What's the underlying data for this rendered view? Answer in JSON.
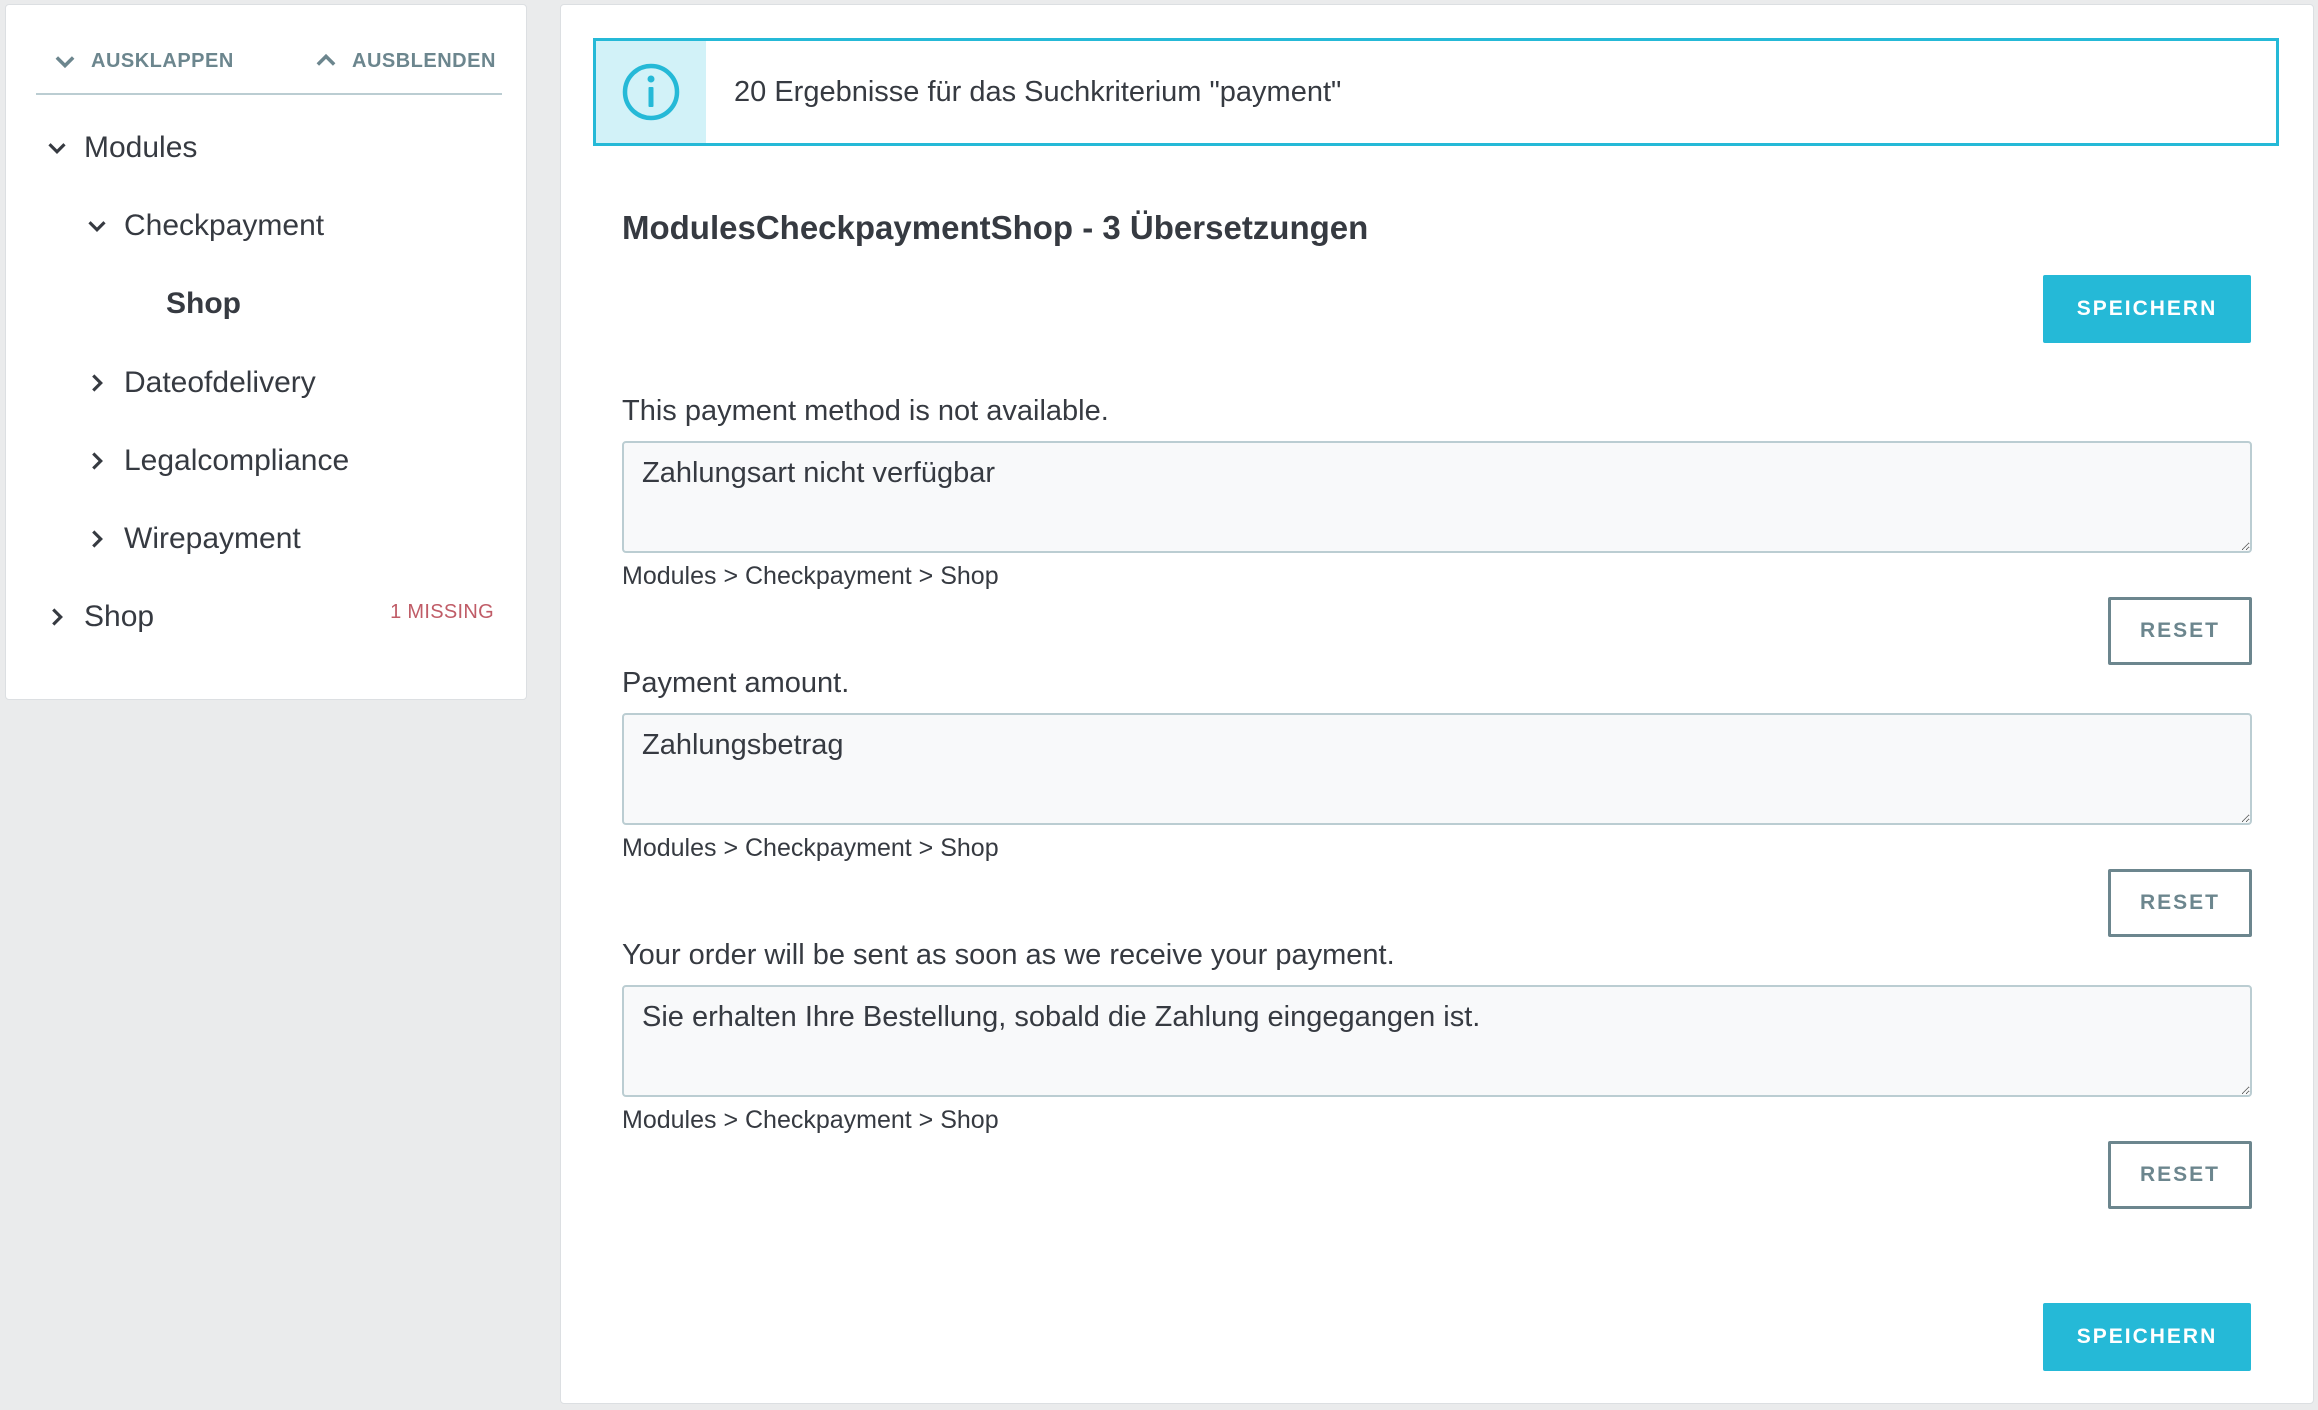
{
  "sidebar": {
    "expand_label": "AUSKLAPPEN",
    "collapse_label": "AUSBLENDEN",
    "tree": [
      {
        "label": "Modules",
        "state": "expanded"
      },
      {
        "label": "Checkpayment",
        "state": "expanded"
      },
      {
        "label": "Shop",
        "state": "selected"
      },
      {
        "label": "Dateofdelivery",
        "state": "collapsed"
      },
      {
        "label": "Legalcompliance",
        "state": "collapsed"
      },
      {
        "label": "Wirepayment",
        "state": "collapsed"
      },
      {
        "label": "Shop",
        "state": "collapsed",
        "badge": "1 MISSING"
      }
    ]
  },
  "alert": {
    "icon": "info-icon",
    "text": "20 Ergebnisse für das Suchkriterium \"payment\""
  },
  "section": {
    "title": "ModulesCheckpaymentShop - 3 Übersetzungen",
    "save_label": "SPEICHERN"
  },
  "translations": [
    {
      "source": "This payment method is not available.",
      "value": "Zahlungsart nicht verfügbar",
      "path": "Modules > Checkpayment > Shop",
      "reset_label": "RESET"
    },
    {
      "source": "Payment amount.",
      "value": "Zahlungsbetrag",
      "path": "Modules > Checkpayment > Shop",
      "reset_label": "RESET"
    },
    {
      "source": "Your order will be sent as soon as we receive your payment.",
      "value": "Sie erhalten Ihre Bestellung, sobald die Zahlung eingegangen ist.",
      "path": "Modules > Checkpayment > Shop",
      "reset_label": "RESET"
    }
  ],
  "colors": {
    "accent": "#25b9d7",
    "alert_icon_bg": "#d2f2f8",
    "missing": "#c05c67",
    "secondary": "#6c868e"
  }
}
